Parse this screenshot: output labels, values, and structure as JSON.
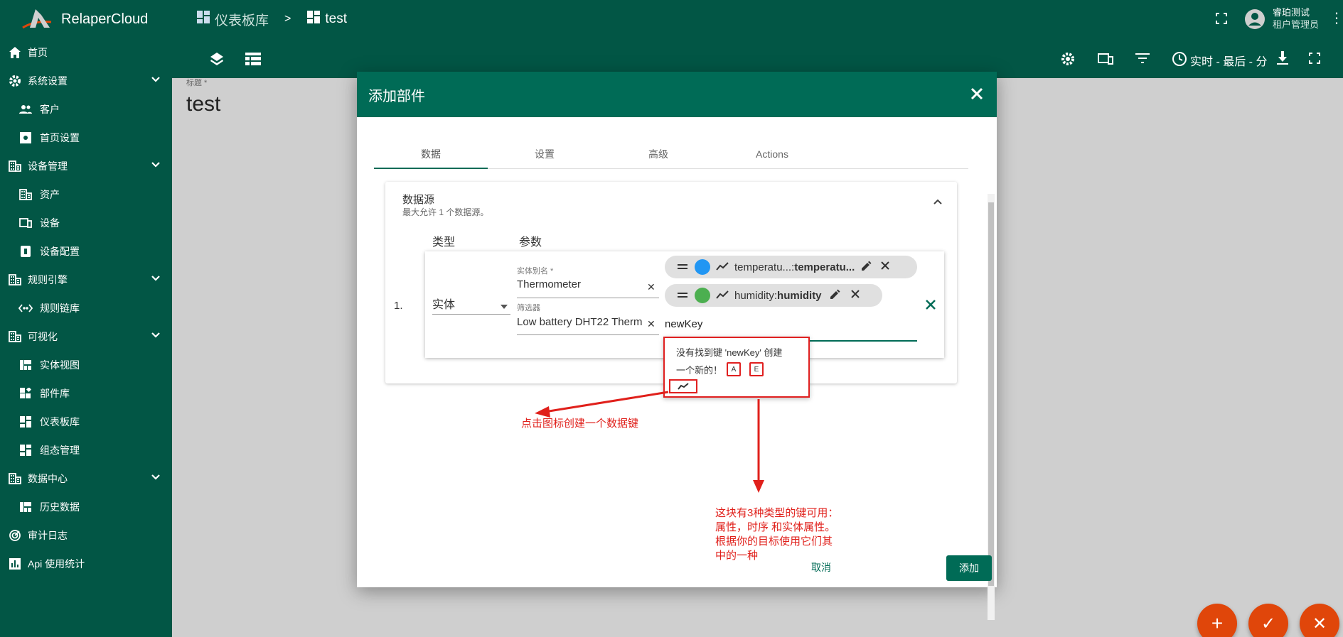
{
  "app": {
    "name": "RelaperCloud"
  },
  "colors": {
    "primary": "#025645",
    "modal_header": "#006b56",
    "accent": "#e0460a",
    "annotation": "#e0201b",
    "chip_blue": "#2196f3",
    "chip_green": "#4caf50"
  },
  "breadcrumb": {
    "parent": "仪表板库",
    "separator": ">",
    "current": "test"
  },
  "user": {
    "name": "睿珀测试",
    "role": "租户管理员"
  },
  "toolbar": {
    "timewindow": "实时 - 最后 - 分"
  },
  "sidebar": {
    "items": [
      {
        "label": "首页",
        "icon": "home-icon"
      },
      {
        "label": "系统设置",
        "icon": "gear-icon"
      },
      {
        "label": "客户",
        "icon": "people-icon"
      },
      {
        "label": "首页设置",
        "icon": "settings-box-icon"
      },
      {
        "label": "设备管理",
        "icon": "building-icon"
      },
      {
        "label": "资产",
        "icon": "building-icon"
      },
      {
        "label": "设备",
        "icon": "devices-icon"
      },
      {
        "label": "设备配置",
        "icon": "device-profile-icon"
      },
      {
        "label": "规则引擎",
        "icon": "building-icon"
      },
      {
        "label": "规则链库",
        "icon": "code-arrows-icon"
      },
      {
        "label": "可视化",
        "icon": "building-icon"
      },
      {
        "label": "实体视图",
        "icon": "view-quilt-icon"
      },
      {
        "label": "部件库",
        "icon": "widgets-icon"
      },
      {
        "label": "仪表板库",
        "icon": "dashboard-icon"
      },
      {
        "label": "组态管理",
        "icon": "dashboard-icon"
      },
      {
        "label": "数据中心",
        "icon": "building-icon"
      },
      {
        "label": "历史数据",
        "icon": "view-quilt-icon"
      },
      {
        "label": "审计日志",
        "icon": "track-changes-icon"
      },
      {
        "label": "Api 使用统计",
        "icon": "insert-chart-icon"
      }
    ]
  },
  "page": {
    "title_label": "标题 *",
    "title": "test"
  },
  "modal": {
    "title": "添加部件",
    "tabs": [
      "数据",
      "设置",
      "高级",
      "Actions"
    ],
    "datasource": {
      "heading": "数据源",
      "subheading": "最大允许 1 个数据源。",
      "col_type": "类型",
      "col_params": "参数",
      "index": "1.",
      "type_value": "实体",
      "alias_label": "实体别名 *",
      "alias_value": "Thermometer",
      "filter_label": "筛选器",
      "filter_value": "Low battery DHT22 Therm",
      "keys": [
        {
          "text": "temperatu...: ",
          "bold": "temperatu...",
          "color": "#2196f3"
        },
        {
          "text": "humidity: ",
          "bold": "humidity",
          "color": "#4caf50"
        }
      ],
      "key_input": "newKey",
      "autocomplete_line1": "没有找到键 'newKey' 创建",
      "autocomplete_line2": "一个新的！",
      "badge_a": "A",
      "badge_e": "E"
    },
    "cancel": "取消",
    "add": "添加"
  },
  "annotations": {
    "click_icon": "点击图标创建一个数据键",
    "types_l1": "这块有3种类型的键可用：",
    "types_l2": "属性，时序 和实体属性。",
    "types_l3": "根据你的目标使用它们其",
    "types_l4": "中的一种"
  }
}
